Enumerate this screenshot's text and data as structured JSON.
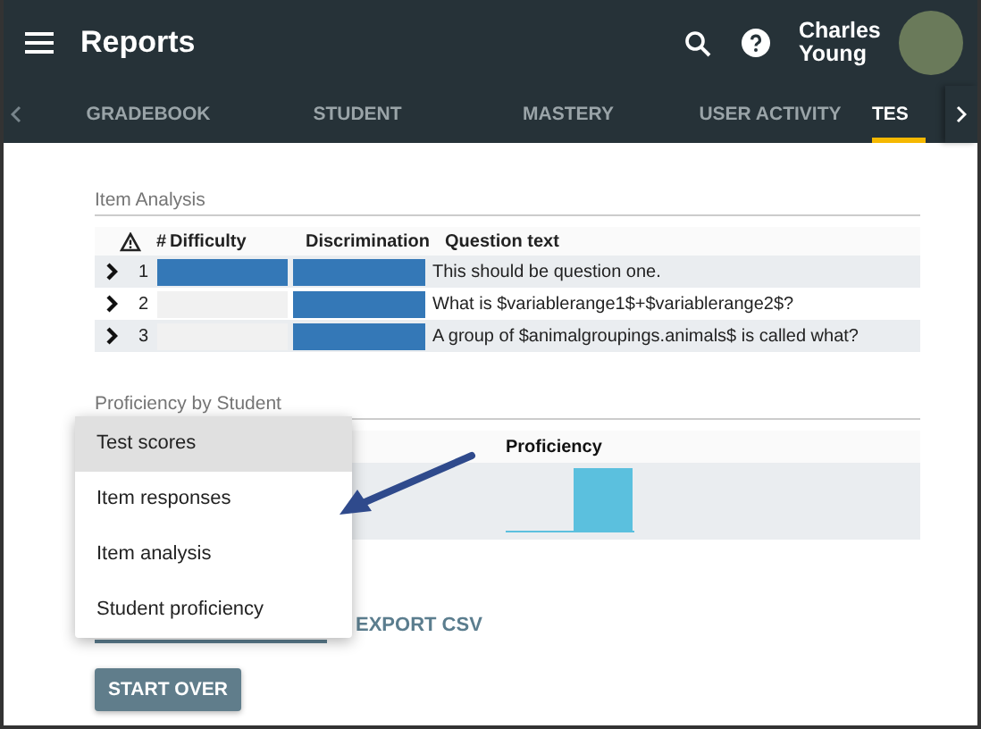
{
  "app_bar": {
    "title": "Reports",
    "user_name": "Charles Young"
  },
  "tabs": [
    {
      "label": "GRADEBOOK",
      "selected": false
    },
    {
      "label": "STUDENT",
      "selected": false
    },
    {
      "label": "MASTERY",
      "selected": false
    },
    {
      "label": "USER ACTIVITY",
      "selected": false
    },
    {
      "label": "TES",
      "selected": true
    }
  ],
  "item_analysis": {
    "title": "Item Analysis",
    "columns": [
      "#",
      "Difficulty",
      "Discrimination",
      "Question text"
    ],
    "rows": [
      {
        "number": "1",
        "difficulty": {
          "level": 1
        },
        "discrimination": {
          "level": 1
        },
        "question": "This should be question one."
      },
      {
        "number": "2",
        "discrimination": {
          "level": 1
        },
        "question": "What is $variablerange1$+$variablerange2$?"
      },
      {
        "number": "3",
        "discrimination": {
          "level": 1
        },
        "question": "A group of $animalgroupings.animals$ is called what?"
      }
    ]
  },
  "proficiency": {
    "title": "Proficiency by Student",
    "column": "Proficiency"
  },
  "export_link": "EXPORT CSV",
  "start_over_button": "START OVER",
  "menu": [
    {
      "label": "Test scores",
      "selected": true
    },
    {
      "label": "Item responses",
      "selected": false
    },
    {
      "label": "Item analysis",
      "selected": false
    },
    {
      "label": "Student proficiency",
      "selected": false
    }
  ]
}
